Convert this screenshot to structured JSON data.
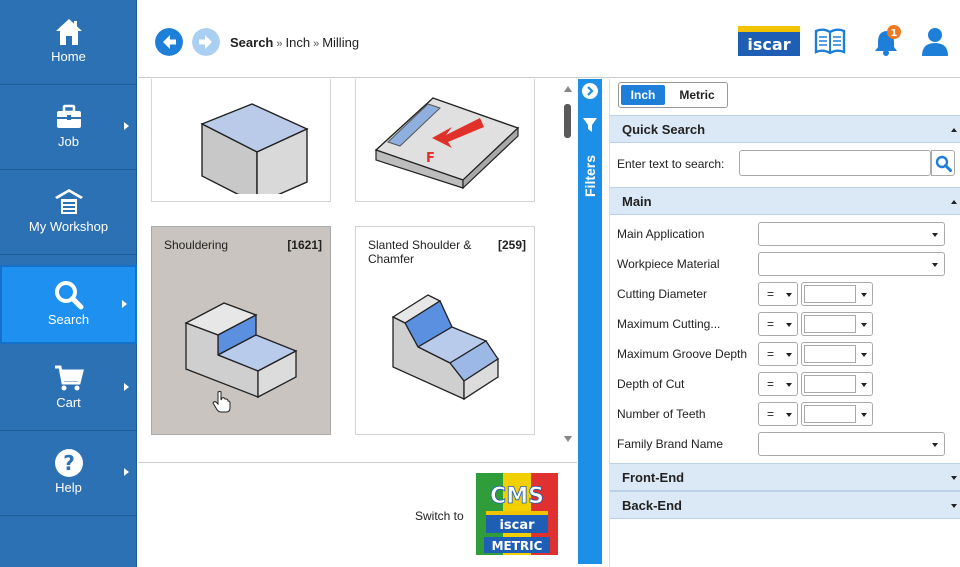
{
  "sidebar": {
    "items": [
      {
        "label": "Home",
        "icon": "home-icon"
      },
      {
        "label": "Job",
        "icon": "briefcase-icon"
      },
      {
        "label": "My Workshop",
        "icon": "workshop-icon"
      },
      {
        "label": "Search",
        "icon": "search-icon"
      },
      {
        "label": "Cart",
        "icon": "cart-icon"
      },
      {
        "label": "Help",
        "icon": "help-icon"
      }
    ],
    "active": "Search",
    "colors": {
      "background": "#2b71b3",
      "active": "#1e90f0"
    }
  },
  "header": {
    "breadcrumb": [
      "Search",
      "Inch",
      "Milling"
    ],
    "breadcrumb_separator": "»",
    "logo_text": "iscar",
    "notification_count": "1",
    "accent": "#1e7fd8"
  },
  "results": {
    "cards": [
      {
        "title": "",
        "count": "",
        "image": "block-icon"
      },
      {
        "title": "",
        "count": "",
        "image": "face-milling-icon"
      },
      {
        "title": "Shouldering",
        "count": "[1621]",
        "image": "shoulder-icon"
      },
      {
        "title": "Slanted Shoulder & Chamfer",
        "count": "[259]",
        "image": "slanted-shoulder-icon"
      }
    ]
  },
  "bottom": {
    "switch_label": "Switch to",
    "cms_logo_top": "CMS",
    "cms_logo_mid": "iscar",
    "cms_logo_bottom": "METRIC"
  },
  "filters_strip": {
    "label": "Filters"
  },
  "panel": {
    "units": {
      "selected": "Inch",
      "other": "Metric"
    },
    "quick_search": {
      "title": "Quick Search",
      "label": "Enter text to search:",
      "value": "",
      "placeholder": ""
    },
    "main": {
      "title": "Main",
      "rows": [
        {
          "label": "Main Application",
          "kind": "select"
        },
        {
          "label": "Workpiece Material",
          "kind": "select"
        },
        {
          "label": "Cutting Diameter",
          "kind": "compare",
          "operator": "="
        },
        {
          "label": "Maximum Cutting...",
          "kind": "compare",
          "operator": "="
        },
        {
          "label": "Maximum Groove Depth",
          "kind": "compare",
          "operator": "="
        },
        {
          "label": "Depth of Cut",
          "kind": "compare",
          "operator": "="
        },
        {
          "label": "Number of Teeth",
          "kind": "compare",
          "operator": "="
        },
        {
          "label": "Family Brand Name",
          "kind": "select"
        }
      ]
    },
    "front_end": {
      "title": "Front-End"
    },
    "back_end": {
      "title": "Back-End"
    }
  }
}
